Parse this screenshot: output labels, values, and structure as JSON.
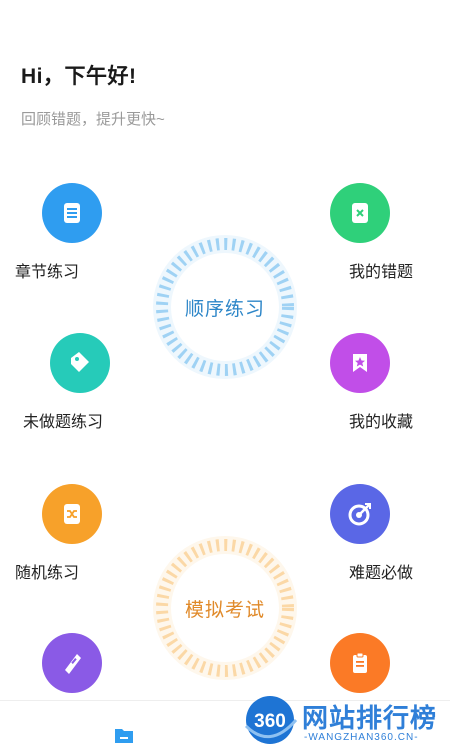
{
  "header": {
    "greeting": "Hi，下午好!",
    "subtitle": "回顾错题，提升更快~"
  },
  "center": {
    "sequential_label": "顺序练习",
    "mock_exam_label": "模拟考试"
  },
  "tiles": {
    "chapter": "章节练习",
    "wrong": "我的错题",
    "undone": "未做题练习",
    "favorites": "我的收藏",
    "random": "随机练习",
    "hard": "难题必做"
  },
  "colors": {
    "chapter": "#2f9df0",
    "wrong": "#2fd07a",
    "undone": "#26cbb9",
    "favorites": "#c14ee8",
    "random": "#f7a12a",
    "hard": "#5a67e6",
    "exam": "#8a5ae6",
    "notes": "#fb7a26",
    "ring_blue": "#9fd2f4",
    "ring_orange": "#fbd8a6"
  },
  "watermark": {
    "logo": "360",
    "title": "网站排行榜",
    "url": "-WANGZHAN360.CN-"
  }
}
